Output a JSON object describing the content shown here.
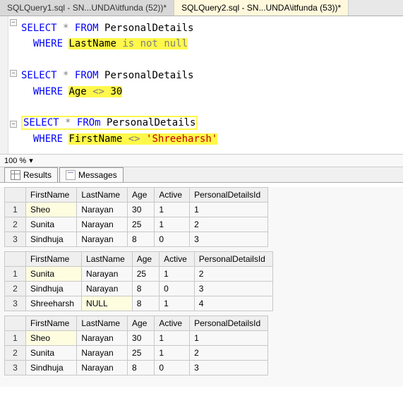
{
  "tabs": [
    {
      "label": "SQLQuery1.sql - SN...UNDA\\itfunda (52))*",
      "active": false
    },
    {
      "label": "SQLQuery2.sql - SN...UNDA\\itfunda (53))*",
      "active": true
    }
  ],
  "sql": {
    "q1": {
      "select": "SELECT",
      "star": "*",
      "from": "FROM",
      "table": "PersonalDetails",
      "where": "WHERE",
      "col": "LastName",
      "op": "is not null"
    },
    "q2": {
      "select": "SELECT",
      "star": "*",
      "from": "FROM",
      "table": "PersonalDetails",
      "where": "WHERE",
      "col": "Age",
      "op": "<>",
      "val": "30"
    },
    "q3": {
      "select": "SELECT",
      "star": "*",
      "from": "FROm",
      "table": "PersonalDetails",
      "where": "WHERE",
      "col": "FirstName",
      "op": "<>",
      "val": "'Shreeharsh'"
    }
  },
  "zoom": "100 %",
  "result_tabs": {
    "results": "Results",
    "messages": "Messages"
  },
  "columns": [
    "FirstName",
    "LastName",
    "Age",
    "Active",
    "PersonalDetailsId"
  ],
  "grids": [
    [
      {
        "FirstName": "Sheo",
        "LastName": "Narayan",
        "Age": 30,
        "Active": 1,
        "PersonalDetailsId": 1
      },
      {
        "FirstName": "Sunita",
        "LastName": "Narayan",
        "Age": 25,
        "Active": 1,
        "PersonalDetailsId": 2
      },
      {
        "FirstName": "Sindhuja",
        "LastName": "Narayan",
        "Age": 8,
        "Active": 0,
        "PersonalDetailsId": 3
      }
    ],
    [
      {
        "FirstName": "Sunita",
        "LastName": "Narayan",
        "Age": 25,
        "Active": 1,
        "PersonalDetailsId": 2
      },
      {
        "FirstName": "Sindhuja",
        "LastName": "Narayan",
        "Age": 8,
        "Active": 0,
        "PersonalDetailsId": 3
      },
      {
        "FirstName": "Shreeharsh",
        "LastName": "NULL",
        "Age": 8,
        "Active": 1,
        "PersonalDetailsId": 4
      }
    ],
    [
      {
        "FirstName": "Sheo",
        "LastName": "Narayan",
        "Age": 30,
        "Active": 1,
        "PersonalDetailsId": 1
      },
      {
        "FirstName": "Sunita",
        "LastName": "Narayan",
        "Age": 25,
        "Active": 1,
        "PersonalDetailsId": 2
      },
      {
        "FirstName": "Sindhuja",
        "LastName": "Narayan",
        "Age": 8,
        "Active": 0,
        "PersonalDetailsId": 3
      }
    ]
  ]
}
